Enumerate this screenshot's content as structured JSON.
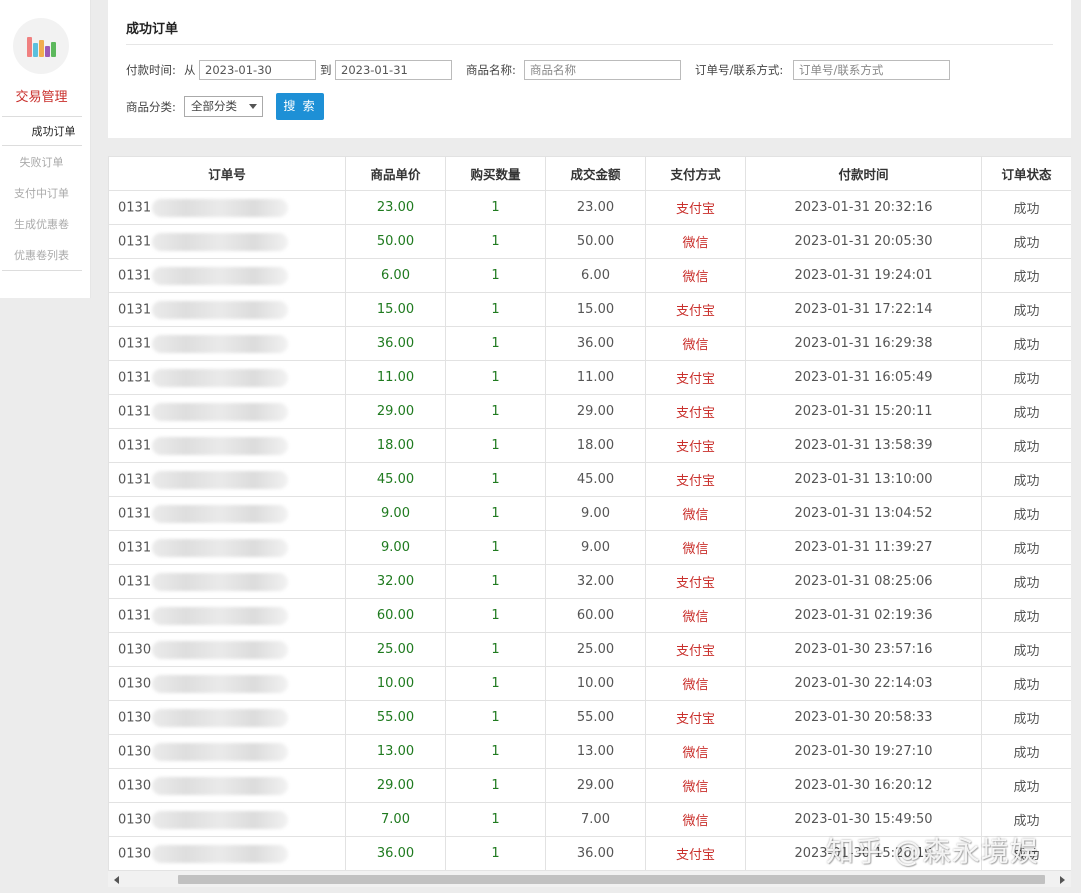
{
  "sidebar": {
    "logo_colors": [
      "#f08080",
      "#5bc0de",
      "#f0ad4e",
      "#9b59b6",
      "#5cb85c"
    ],
    "section_title": "交易管理",
    "items": [
      {
        "label": "成功订单",
        "active": true
      },
      {
        "label": "失败订单",
        "active": false
      },
      {
        "label": "支付中订单",
        "active": false
      },
      {
        "label": "生成优惠卷",
        "active": false
      },
      {
        "label": "优惠卷列表",
        "active": false
      }
    ]
  },
  "search": {
    "title": "成功订单",
    "pay_time_label": "付款时间:",
    "from_label": "从",
    "from_value": "2023-01-30",
    "to_label": "到",
    "to_value": "2023-01-31",
    "product_name_label": "商品名称:",
    "product_name_placeholder": "商品名称",
    "order_contact_label": "订单号/联系方式:",
    "order_contact_placeholder": "订单号/联系方式",
    "category_label": "商品分类:",
    "category_value": "全部分类",
    "search_button": "搜 索"
  },
  "table": {
    "headers": [
      "订单号",
      "商品单价",
      "购买数量",
      "成交金额",
      "支付方式",
      "付款时间",
      "订单状态"
    ],
    "rows": [
      {
        "order": "0131",
        "price": "23.00",
        "qty": "1",
        "amount": "23.00",
        "pay": "支付宝",
        "time": "2023-01-31 20:32:16",
        "status": "成功"
      },
      {
        "order": "0131",
        "price": "50.00",
        "qty": "1",
        "amount": "50.00",
        "pay": "微信",
        "time": "2023-01-31 20:05:30",
        "status": "成功"
      },
      {
        "order": "0131",
        "price": "6.00",
        "qty": "1",
        "amount": "6.00",
        "pay": "微信",
        "time": "2023-01-31 19:24:01",
        "status": "成功"
      },
      {
        "order": "0131",
        "price": "15.00",
        "qty": "1",
        "amount": "15.00",
        "pay": "支付宝",
        "time": "2023-01-31 17:22:14",
        "status": "成功"
      },
      {
        "order": "0131",
        "price": "36.00",
        "qty": "1",
        "amount": "36.00",
        "pay": "微信",
        "time": "2023-01-31 16:29:38",
        "status": "成功"
      },
      {
        "order": "0131",
        "price": "11.00",
        "qty": "1",
        "amount": "11.00",
        "pay": "支付宝",
        "time": "2023-01-31 16:05:49",
        "status": "成功"
      },
      {
        "order": "0131",
        "price": "29.00",
        "qty": "1",
        "amount": "29.00",
        "pay": "支付宝",
        "time": "2023-01-31 15:20:11",
        "status": "成功"
      },
      {
        "order": "0131",
        "price": "18.00",
        "qty": "1",
        "amount": "18.00",
        "pay": "支付宝",
        "time": "2023-01-31 13:58:39",
        "status": "成功"
      },
      {
        "order": "0131",
        "price": "45.00",
        "qty": "1",
        "amount": "45.00",
        "pay": "支付宝",
        "time": "2023-01-31 13:10:00",
        "status": "成功"
      },
      {
        "order": "0131",
        "price": "9.00",
        "qty": "1",
        "amount": "9.00",
        "pay": "微信",
        "time": "2023-01-31 13:04:52",
        "status": "成功"
      },
      {
        "order": "0131",
        "price": "9.00",
        "qty": "1",
        "amount": "9.00",
        "pay": "微信",
        "time": "2023-01-31 11:39:27",
        "status": "成功"
      },
      {
        "order": "0131",
        "price": "32.00",
        "qty": "1",
        "amount": "32.00",
        "pay": "支付宝",
        "time": "2023-01-31 08:25:06",
        "status": "成功"
      },
      {
        "order": "0131",
        "price": "60.00",
        "qty": "1",
        "amount": "60.00",
        "pay": "微信",
        "time": "2023-01-31 02:19:36",
        "status": "成功"
      },
      {
        "order": "0130",
        "price": "25.00",
        "qty": "1",
        "amount": "25.00",
        "pay": "支付宝",
        "time": "2023-01-30 23:57:16",
        "status": "成功"
      },
      {
        "order": "0130",
        "price": "10.00",
        "qty": "1",
        "amount": "10.00",
        "pay": "微信",
        "time": "2023-01-30 22:14:03",
        "status": "成功"
      },
      {
        "order": "0130",
        "price": "55.00",
        "qty": "1",
        "amount": "55.00",
        "pay": "支付宝",
        "time": "2023-01-30 20:58:33",
        "status": "成功"
      },
      {
        "order": "0130",
        "price": "13.00",
        "qty": "1",
        "amount": "13.00",
        "pay": "微信",
        "time": "2023-01-30 19:27:10",
        "status": "成功"
      },
      {
        "order": "0130",
        "price": "29.00",
        "qty": "1",
        "amount": "29.00",
        "pay": "微信",
        "time": "2023-01-30 16:20:12",
        "status": "成功"
      },
      {
        "order": "0130",
        "price": "7.00",
        "qty": "1",
        "amount": "7.00",
        "pay": "微信",
        "time": "2023-01-30 15:49:50",
        "status": "成功"
      },
      {
        "order": "0130",
        "price": "36.00",
        "qty": "1",
        "amount": "36.00",
        "pay": "支付宝",
        "time": "2023-01-30 15:20:19",
        "status": "成功"
      }
    ]
  },
  "watermark": "知乎 @森永境娱"
}
